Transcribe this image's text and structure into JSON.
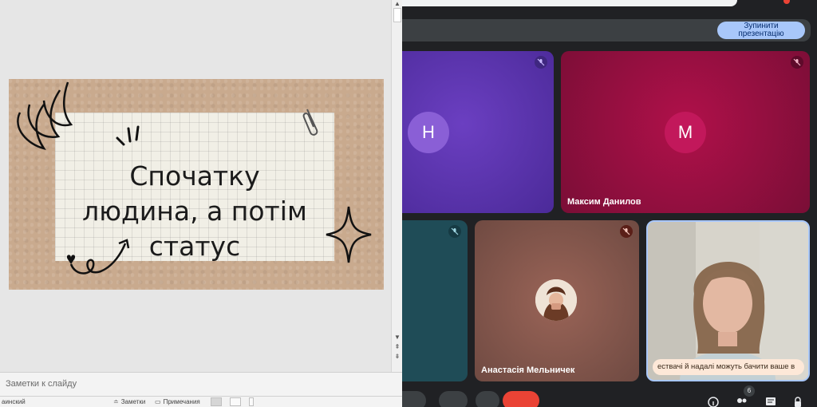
{
  "powerpoint": {
    "slide": {
      "lines": [
        "Спочатку",
        "людина, а потім",
        "статус"
      ]
    },
    "notes_placeholder": "Заметки к слайду",
    "statusbar": {
      "language": "аинский",
      "notes_label": "Заметки",
      "comments_label": "Примечания"
    }
  },
  "meet": {
    "stop_presenting": [
      "Зупинити",
      "презентацію"
    ],
    "tiles": [
      {
        "avatar_letter": "Н",
        "name": "",
        "color": "#6b3fc1"
      },
      {
        "avatar_letter": "М",
        "name": "Максим Данилов",
        "color": "#c2185b"
      },
      {
        "avatar_letter": "",
        "name": "",
        "color": "#1f4c57"
      },
      {
        "avatar_letter": "",
        "name": "Анастасія Мельничек",
        "color": "#9a6457"
      },
      {
        "avatar_letter": "",
        "name": "",
        "color": "#cfcdc4"
      }
    ],
    "caption": "ествачі й надалі можуть бачити ваше в",
    "participants_count": "6",
    "accent": "#a8c7fa",
    "end_call_color": "#ea4335"
  }
}
